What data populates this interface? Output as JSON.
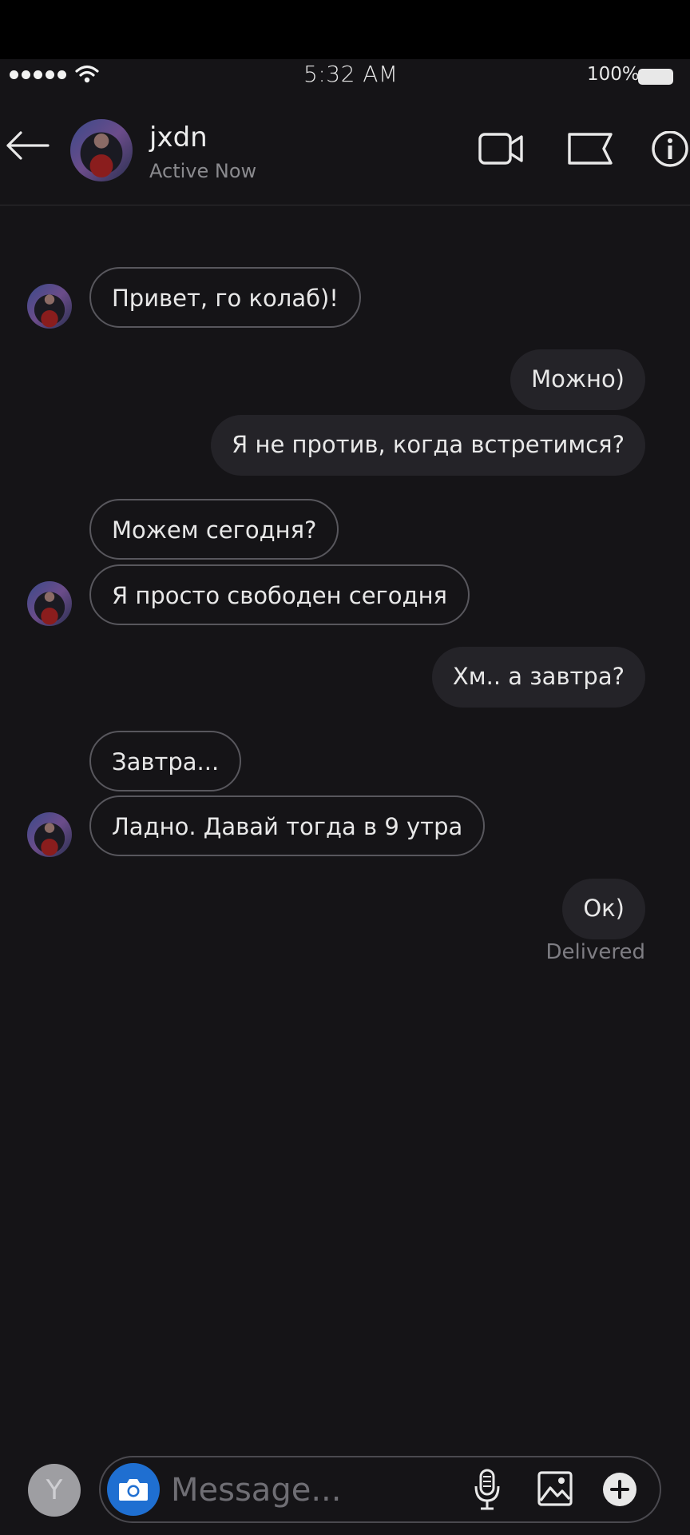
{
  "status_bar": {
    "time": "5:32 AM",
    "battery_percent": "100%",
    "battery_level": 1.0,
    "icons": [
      "signal-dots-icon",
      "wifi-icon",
      "battery-icon"
    ]
  },
  "header": {
    "back_icon": "back-arrow-icon",
    "contact_name": "jxdn",
    "contact_status": "Active Now",
    "actions": [
      "video-call-icon",
      "flag-icon",
      "info-icon"
    ]
  },
  "messages": [
    {
      "direction": "in",
      "text": "Привет, го колаб)!"
    },
    {
      "direction": "out",
      "text": "Можно)"
    },
    {
      "direction": "out",
      "text": "Я не против, когда встретимся?"
    },
    {
      "direction": "in",
      "text": "Можем сегодня?"
    },
    {
      "direction": "in",
      "text": "Я просто свободен сегодня"
    },
    {
      "direction": "out",
      "text": "Хм.. а завтра?"
    },
    {
      "direction": "in",
      "text": "Завтра..."
    },
    {
      "direction": "in",
      "text": "Ладно. Давай тогда в 9 утра"
    },
    {
      "direction": "out",
      "text": "Ок)"
    }
  ],
  "delivery_status": "Delivered",
  "composer": {
    "user_avatar_letter": "Y",
    "placeholder": "Message...",
    "icons": [
      "camera-icon",
      "microphone-icon",
      "image-icon",
      "plus-icon"
    ]
  },
  "colors": {
    "background": "#151417",
    "outgoing_bubble": "#242328",
    "incoming_border": "#58575d",
    "camera_button": "#1f6fd1"
  }
}
